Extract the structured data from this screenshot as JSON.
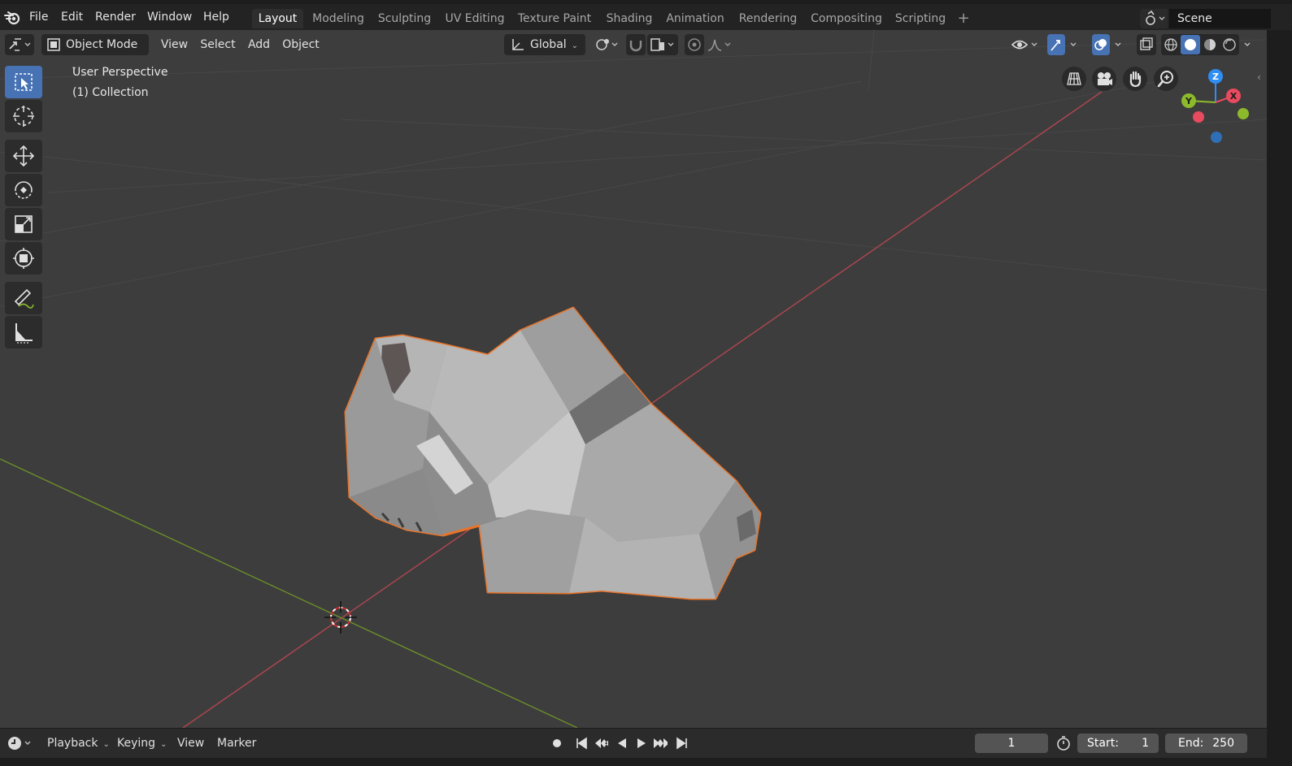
{
  "menubar": {
    "items": [
      "File",
      "Edit",
      "Render",
      "Window",
      "Help"
    ]
  },
  "workspaces": {
    "tabs": [
      "Layout",
      "Modeling",
      "Sculpting",
      "UV Editing",
      "Texture Paint",
      "Shading",
      "Animation",
      "Rendering",
      "Compositing",
      "Scripting"
    ],
    "active": "Layout",
    "add_symbol": "+"
  },
  "scene": {
    "name": "Scene"
  },
  "viewport_header": {
    "mode": "Object Mode",
    "menus": [
      "View",
      "Select",
      "Add",
      "Object"
    ],
    "transform_orientation": "Global"
  },
  "viewport": {
    "perspective_label": "User Perspective",
    "collection_label": "(1) Collection"
  },
  "gizmo": {
    "x": "X",
    "y": "Y",
    "z": "Z"
  },
  "timeline": {
    "menus": [
      "Playback",
      "Keying",
      "View",
      "Marker"
    ],
    "current_frame": "1",
    "start_label": "Start:",
    "start_value": "1",
    "end_label": "End:",
    "end_value": "250"
  },
  "colors": {
    "selection_outline": "#e8742a",
    "active_tool": "#4772b3",
    "axis_x": "#e84a5f",
    "axis_y": "#8cba2b",
    "axis_z": "#2e8ef5"
  }
}
